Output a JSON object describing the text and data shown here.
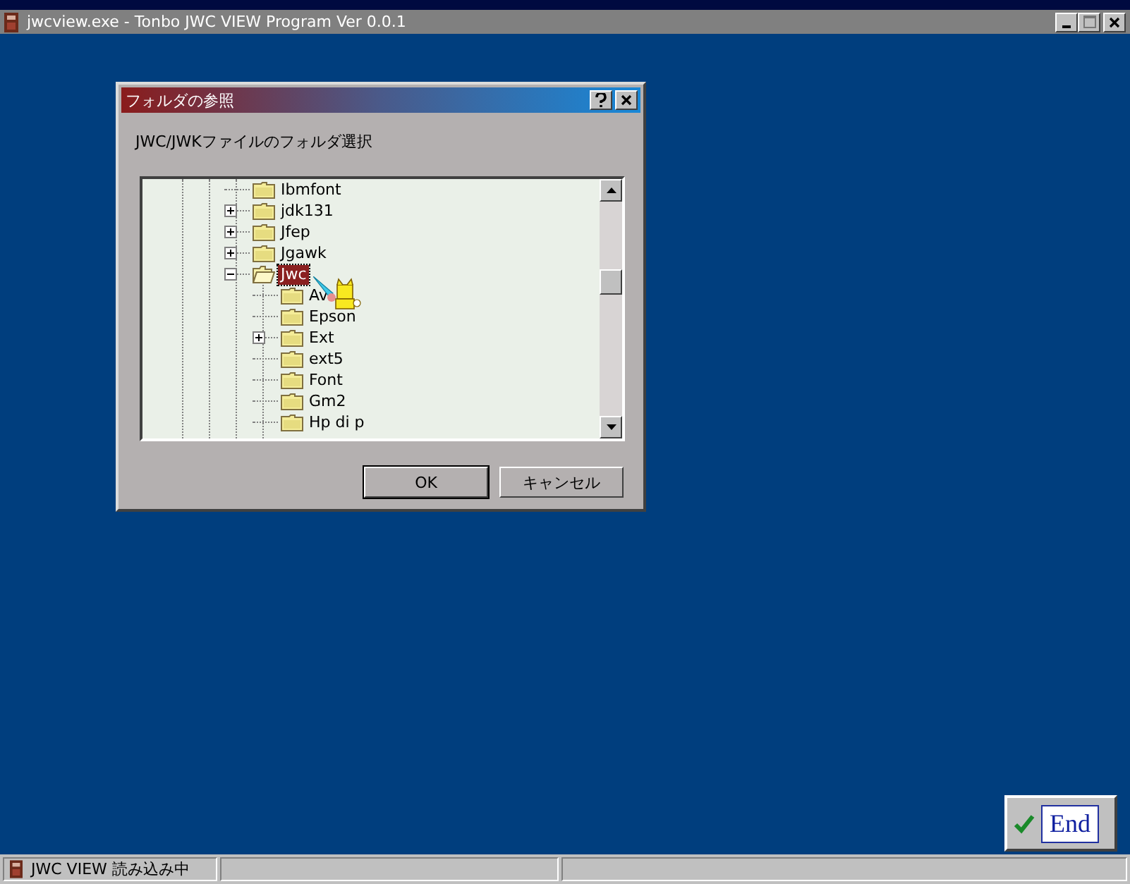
{
  "window": {
    "title": "jwcview.exe - Tonbo JWC VIEW Program Ver 0.0.1"
  },
  "dialog": {
    "title": "フォルダの参照",
    "prompt": "JWC/JWKファイルのフォルダ選択",
    "tree": [
      {
        "label": "Ibmfont",
        "selected": false
      },
      {
        "label": "jdk131",
        "selected": false,
        "expanded": false
      },
      {
        "label": "Jfep",
        "selected": false,
        "expanded": false
      },
      {
        "label": "Jgawk",
        "selected": false,
        "expanded": false
      },
      {
        "label": "Jwc",
        "selected": true,
        "expanded": true,
        "children": [
          {
            "label": "Av",
            "selected": false
          },
          {
            "label": "Epson",
            "selected": false
          },
          {
            "label": "Ext",
            "selected": false,
            "expanded": false
          },
          {
            "label": "ext5",
            "selected": false
          },
          {
            "label": "Font",
            "selected": false
          },
          {
            "label": "Gm2",
            "selected": false
          },
          {
            "label": "Hp di p",
            "selected": false
          }
        ]
      }
    ],
    "buttons": [
      "OK",
      "キャンセル"
    ]
  },
  "end_button": {
    "label": "End"
  },
  "status_bar": {
    "text": "JWC VIEW 読み込み中"
  }
}
